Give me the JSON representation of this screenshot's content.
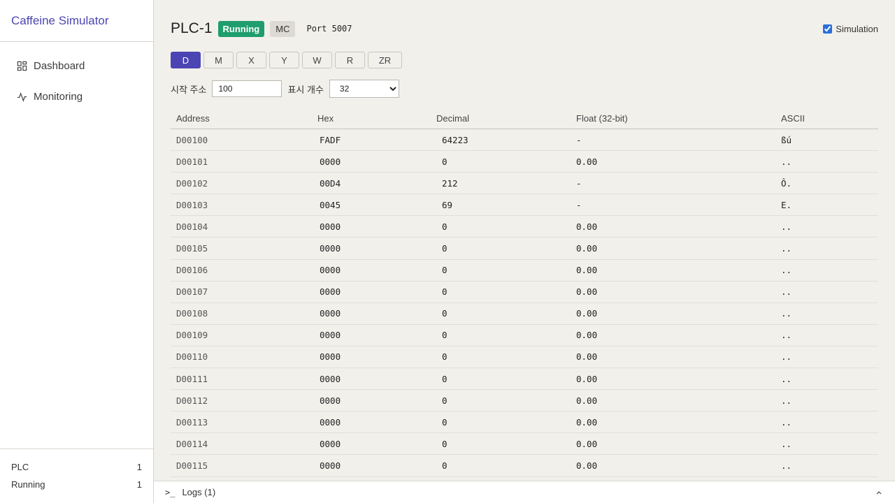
{
  "app": {
    "title": "Caffeine Simulator"
  },
  "sidebar": {
    "items": [
      {
        "label": "Dashboard",
        "icon": "dashboard-icon"
      },
      {
        "label": "Monitoring",
        "icon": "activity-icon"
      }
    ],
    "stats": [
      {
        "label": "PLC",
        "value": "1"
      },
      {
        "label": "Running",
        "value": "1"
      }
    ]
  },
  "header": {
    "title": "PLC-1",
    "status": "Running",
    "protocol": "MC",
    "port": "Port 5007",
    "simulation_label": "Simulation",
    "simulation_checked": true
  },
  "device_tabs": [
    "D",
    "M",
    "X",
    "Y",
    "W",
    "R",
    "ZR"
  ],
  "active_tab": "D",
  "filters": {
    "start_label": "시작 주소",
    "start_value": "100",
    "count_label": "표시 개수",
    "count_value": "32"
  },
  "table": {
    "columns": [
      "Address",
      "Hex",
      "Decimal",
      "Float (32-bit)",
      "ASCII"
    ],
    "rows": [
      [
        "D00100",
        "FADF",
        "64223",
        "-",
        "ßú"
      ],
      [
        "D00101",
        "0000",
        "0",
        "0.00",
        ".."
      ],
      [
        "D00102",
        "00D4",
        "212",
        "-",
        "Ô."
      ],
      [
        "D00103",
        "0045",
        "69",
        "-",
        "E."
      ],
      [
        "D00104",
        "0000",
        "0",
        "0.00",
        ".."
      ],
      [
        "D00105",
        "0000",
        "0",
        "0.00",
        ".."
      ],
      [
        "D00106",
        "0000",
        "0",
        "0.00",
        ".."
      ],
      [
        "D00107",
        "0000",
        "0",
        "0.00",
        ".."
      ],
      [
        "D00108",
        "0000",
        "0",
        "0.00",
        ".."
      ],
      [
        "D00109",
        "0000",
        "0",
        "0.00",
        ".."
      ],
      [
        "D00110",
        "0000",
        "0",
        "0.00",
        ".."
      ],
      [
        "D00111",
        "0000",
        "0",
        "0.00",
        ".."
      ],
      [
        "D00112",
        "0000",
        "0",
        "0.00",
        ".."
      ],
      [
        "D00113",
        "0000",
        "0",
        "0.00",
        ".."
      ],
      [
        "D00114",
        "0000",
        "0",
        "0.00",
        ".."
      ],
      [
        "D00115",
        "0000",
        "0",
        "0.00",
        ".."
      ]
    ]
  },
  "logs": {
    "label": "Logs (1)"
  },
  "colors": {
    "accent": "#4b45b3",
    "running": "#1f9d6e"
  }
}
